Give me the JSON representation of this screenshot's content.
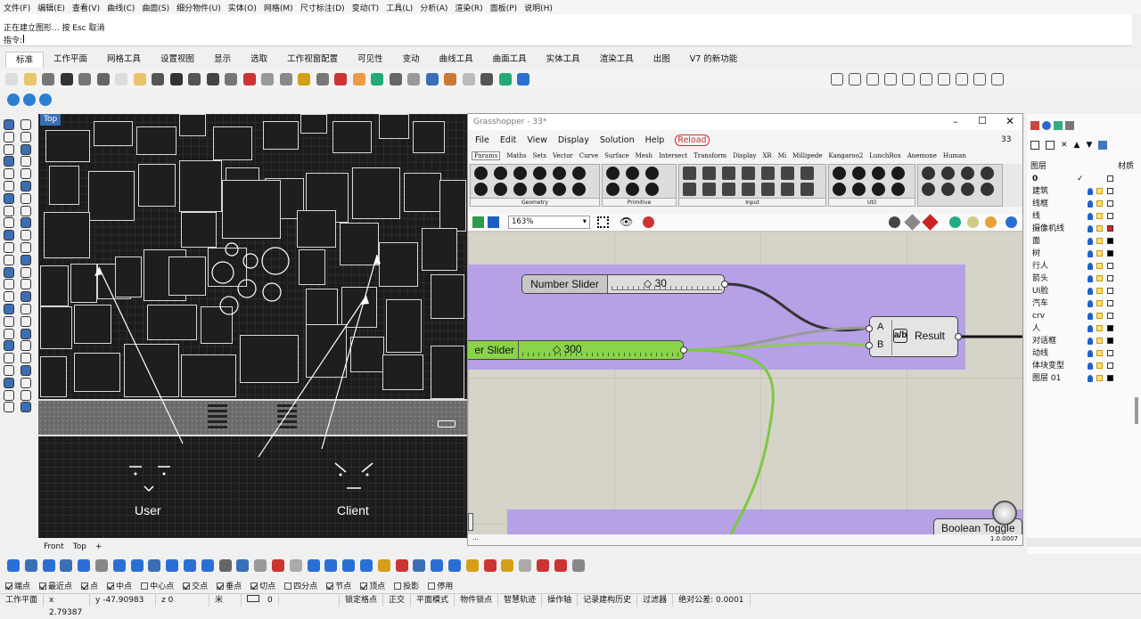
{
  "menu": [
    "文件(F)",
    "编辑(E)",
    "查看(V)",
    "曲线(C)",
    "曲面(S)",
    "细分物件(U)",
    "实体(O)",
    "网格(M)",
    "尺寸标注(D)",
    "变动(T)",
    "工具(L)",
    "分析(A)",
    "渲染(R)",
    "面板(P)",
    "说明(H)"
  ],
  "command": {
    "line1": "正在建立图形... 按 Esc 取消",
    "prompt": "指令:"
  },
  "tabs": [
    "标准",
    "工作平面",
    "网格工具",
    "设置视图",
    "显示",
    "选取",
    "工作视窗配置",
    "可见性",
    "变动",
    "曲线工具",
    "曲面工具",
    "实体工具",
    "渲染工具",
    "出图",
    "V7 的新功能"
  ],
  "viewport": {
    "label": "Top",
    "person_user": "User",
    "person_client": "Client",
    "tabs": [
      "Front",
      "Top"
    ]
  },
  "gh": {
    "title": "Grasshopper - 33*",
    "menu": [
      "File",
      "Edit",
      "View",
      "Display",
      "Solution",
      "Help"
    ],
    "reload": "Reload",
    "doc_count": "33",
    "tabs": [
      "Params",
      "Maths",
      "Sets",
      "Vector",
      "Curve",
      "Surface",
      "Mesh",
      "Intersect",
      "Transform",
      "Display",
      "XR",
      "Mi",
      "Millipede",
      "Kangaroo2",
      "LunchBox",
      "Anemone",
      "Human"
    ],
    "groups": [
      "Geometry",
      "Primitive",
      "Input",
      "Util"
    ],
    "zoom": "163%",
    "slider1": {
      "name": "Number Slider",
      "value": "30"
    },
    "slider2": {
      "name": "er Slider",
      "value": "300"
    },
    "division": {
      "inA": "A",
      "inB": "B",
      "out": "Result"
    },
    "toggle": "Boolean Toggle",
    "status": "1.0.0007",
    "status_left": "..."
  },
  "layers": {
    "header_name": "图层",
    "header_mat": "材质",
    "rows": [
      {
        "name": "0",
        "color": "#ffffff",
        "current": true
      },
      {
        "name": "建筑",
        "color": "#ffffff"
      },
      {
        "name": "线框",
        "color": "#ffffff"
      },
      {
        "name": "线",
        "color": "#ffffff"
      },
      {
        "name": "摄像机线",
        "color": "#e02020"
      },
      {
        "name": "面",
        "color": "#000000"
      },
      {
        "name": "树",
        "color": "#000000"
      },
      {
        "name": "行人",
        "color": "#ffffff"
      },
      {
        "name": "箭头",
        "color": "#ffffff"
      },
      {
        "name": "UI脸",
        "color": "#ffffff"
      },
      {
        "name": "汽车",
        "color": "#ffffff"
      },
      {
        "name": "crv",
        "color": "#ffffff"
      },
      {
        "name": "人",
        "color": "#000000"
      },
      {
        "name": "对话框",
        "color": "#000000"
      },
      {
        "name": "动线",
        "color": "#ffffff"
      },
      {
        "name": "体块变型",
        "color": "#ffffff"
      },
      {
        "name": "图层 01",
        "color": "#000000"
      }
    ]
  },
  "snaps": [
    {
      "label": "端点",
      "on": true
    },
    {
      "label": "最近点",
      "on": true
    },
    {
      "label": "点",
      "on": true
    },
    {
      "label": "中点",
      "on": true
    },
    {
      "label": "中心点",
      "on": false
    },
    {
      "label": "交点",
      "on": true
    },
    {
      "label": "垂点",
      "on": true
    },
    {
      "label": "切点",
      "on": true
    },
    {
      "label": "四分点",
      "on": false
    },
    {
      "label": "节点",
      "on": true
    },
    {
      "label": "顶点",
      "on": true
    },
    {
      "label": "投影",
      "on": false
    },
    {
      "label": "停用",
      "on": false
    }
  ],
  "status": {
    "plane": "工作平面",
    "x": "x 2.79387",
    "y": "y -47.90983",
    "z": "z 0",
    "unit": "米",
    "layer": "0",
    "items": [
      "锁定格点",
      "正交",
      "平面模式",
      "物件锁点",
      "智慧轨迹",
      "操作轴",
      "记录建构历史",
      "过滤器",
      "绝对公差: 0.0001"
    ]
  }
}
